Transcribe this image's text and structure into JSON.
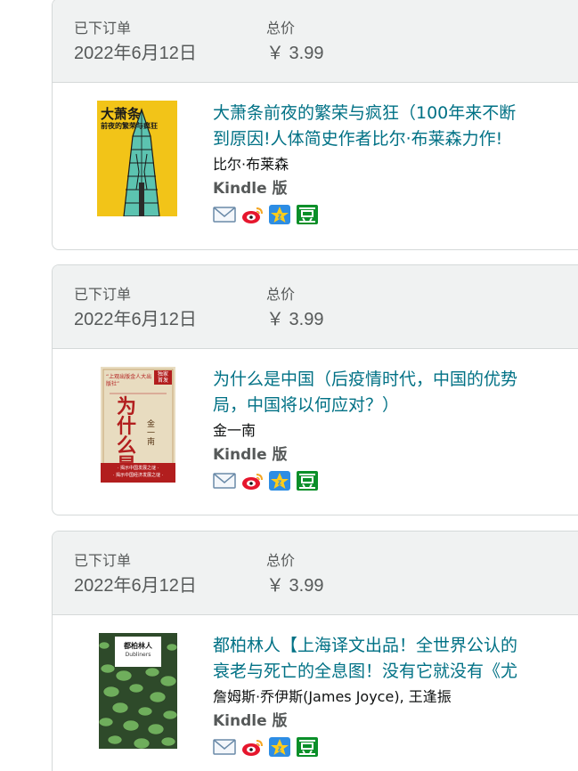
{
  "orders": [
    {
      "order_date_label": "已下订单",
      "order_date": "2022年6月12日",
      "total_label": "总价",
      "total": "￥ 3.99",
      "item": {
        "title_line1": "大萧条前夜的繁荣与疯狂（100年来不断",
        "title_line2": "到原因!人体简史作者比尔·布莱森力作!",
        "author": "比尔·布莱森",
        "format": "Kindle 版",
        "cover": {
          "title": "大萧条",
          "subtitle": "前夜的繁荣与疯狂",
          "bg": "#f2c418",
          "accent": "#5cc3b0"
        }
      }
    },
    {
      "order_date_label": "已下订单",
      "order_date": "2022年6月12日",
      "total_label": "总价",
      "total": "￥ 3.99",
      "item": {
        "title_line1": "为什么是中国（后疫情时代，中国的优势",
        "title_line2": "局，中国将以何应对？）",
        "author": "金一南",
        "format": "Kindle 版",
        "cover": {
          "title": "为什么是中国",
          "subtitle": "“上观出版金人大出版社”",
          "badge": "独家首发",
          "author": "金一南",
          "bottom_line1": "· 揭示中国发展之谜 ·",
          "bottom_line2": "· 揭示中国经济发展之谜 ·",
          "bg": "#e8dcc0",
          "accent": "#b21e1e"
        }
      }
    },
    {
      "order_date_label": "已下订单",
      "order_date": "2022年6月12日",
      "total_label": "总价",
      "total": "￥ 3.99",
      "item": {
        "title_line1": "都柏林人【上海译文出品！全世界公认的",
        "title_line2": "衰老与死亡的全息图！没有它就没有《尤",
        "author": "詹姆斯·乔伊斯(James Joyce), 王逢振",
        "format": "Kindle 版",
        "cover": {
          "title": "都柏林人",
          "subtitle": "Dubliners",
          "bg": "#2e4a2a",
          "accent": "#6fae5c"
        }
      }
    }
  ],
  "share_icons": [
    "email-icon",
    "weibo-icon",
    "qzone-icon",
    "douban-icon"
  ]
}
